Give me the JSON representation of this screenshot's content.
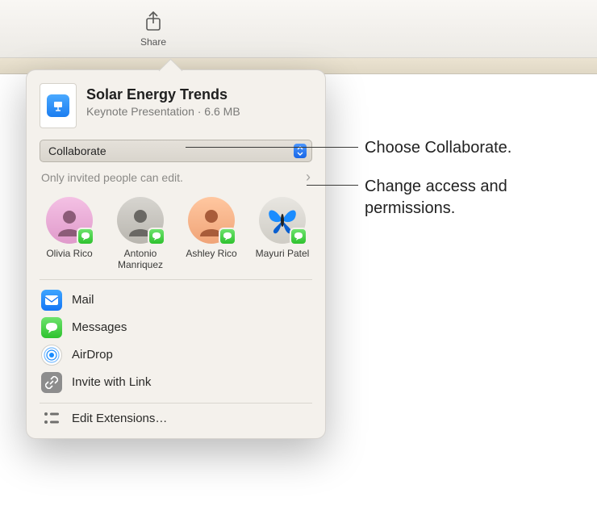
{
  "toolbar": {
    "share_label": "Share"
  },
  "document": {
    "title": "Solar Energy Trends",
    "subtitle": "Keynote Presentation · 6.6 MB"
  },
  "share_mode": {
    "value": "Collaborate"
  },
  "permissions": {
    "summary": "Only invited people can edit."
  },
  "contacts": [
    {
      "name": "Olivia Rico",
      "avatar_color": "linear-gradient(#f4c1e4,#e09acb)"
    },
    {
      "name": "Antonio Manriquez",
      "avatar_color": "linear-gradient(#d7d5d0,#b9b6af)"
    },
    {
      "name": "Ashley Rico",
      "avatar_color": "linear-gradient(#ffc7a0,#f0a478)"
    },
    {
      "name": "Mayuri Patel",
      "avatar_color": "linear-gradient(#d7d5d0,#b9b6af)",
      "butterfly": true
    }
  ],
  "share_options": {
    "mail": "Mail",
    "messages": "Messages",
    "airdrop": "AirDrop",
    "invite_link": "Invite with Link"
  },
  "extensions": {
    "edit": "Edit Extensions…"
  },
  "callouts": {
    "choose": "Choose Collaborate.",
    "access": "Change access and permissions."
  }
}
